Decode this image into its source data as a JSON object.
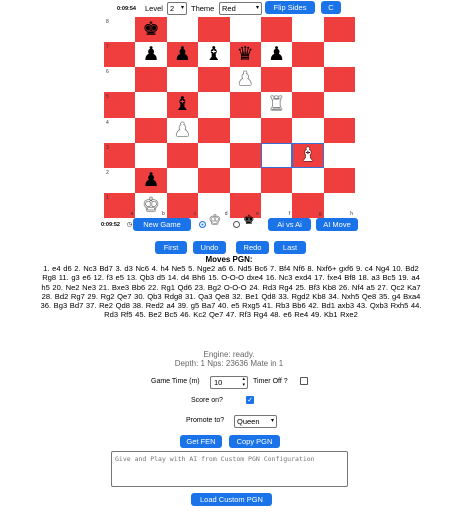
{
  "top_bar": {
    "timer_top": "0:09:54",
    "level_label": "Level",
    "level_value": "2",
    "theme_label": "Theme",
    "theme_value": "Red",
    "flip_label": "Flip Sides",
    "c_label": "C"
  },
  "board": {
    "files": [
      "a",
      "b",
      "c",
      "d",
      "e",
      "f",
      "g",
      "h"
    ],
    "ranks": [
      "8",
      "7",
      "6",
      "5",
      "4",
      "3",
      "2",
      "1"
    ],
    "rows": [
      [
        "",
        "bK",
        "",
        "",
        "",
        "",
        "",
        ""
      ],
      [
        "",
        "bP",
        "bP",
        "bB",
        "bQ",
        "bP",
        "",
        ""
      ],
      [
        "",
        "",
        "",
        "",
        "wP",
        "",
        "",
        ""
      ],
      [
        "",
        "",
        "bB",
        "",
        "",
        "wR",
        "",
        ""
      ],
      [
        "",
        "",
        "wP",
        "",
        "",
        "",
        "",
        ""
      ],
      [
        "",
        "",
        "",
        "",
        "",
        "",
        "wB",
        ""
      ],
      [
        "",
        "bP",
        "",
        "",
        "",
        "",
        "",
        ""
      ],
      [
        "",
        "wK",
        "",
        "",
        "",
        "",
        "",
        ""
      ]
    ],
    "highlight": [
      [
        5,
        5
      ],
      [
        5,
        6
      ]
    ]
  },
  "controls": {
    "timer_bottom": "0:09:52",
    "new_game_label": "New Game",
    "ai_vs_ai_label": "Ai vs Ai",
    "ai_move_label": "AI Move",
    "first_label": "First",
    "undo_label": "Undo",
    "redo_label": "Redo",
    "last_label": "Last"
  },
  "moves": {
    "title": "Moves PGN:",
    "text": "1. e4 d6 2. Nc3 Bd7 3. d3 Nc6 4. h4 Ne5 5. Nge2 a6 6. Nd5 Bc6 7. Bf4 Nf6 8. Nxf6+ gxf6 9. c4 Ng4 10. Bd2 Rg8 11. g3 e6 12. f3 e5 13. Qb3 d5 14. d4 Bh6 15. O-O-O dxe4 16. Nc3 exd4 17. fxe4 Bf8 18. a3 Bc5 19. a4 h5 20. Ne2 Ne3 21. Bxe3 Bb6 22. Rg1 Qd6 23. Bg2 O-O-O 24. Rd3 Rg4 25. Bf3 Kb8 26. Nf4 a5 27. Qc2 Ka7 28. Bd2 Rg7 29. Rg2 Qe7 30. Qb3 Rdg8 31. Qa3 Qe8 32. Be1 Qd8 33. Rgd2 Kb8 34. Nxh5 Qe8 35. g4 Bxa4 36. Bg3 Bd7 37. Re2 Qd8 38. Red2 a4 39. g5 Ba7 40. e5 Rxg5 41. Rb3 Bb6 42. Bd1 axb3 43. Qxb3 Rxh5 44. Rd3 Rf5 45. Be2 Bc5 46. Kc2 Qe7 47. Rf3 Rg4 48. e6 Re4 49. Kb1 Rxe2"
  },
  "engine": {
    "status": "Engine: ready.",
    "depth": "Depth: 1 Nps: 23636 Mate in 1"
  },
  "settings": {
    "game_time_label": "Game Time (m)",
    "game_time_value": "10",
    "timer_off_label": "Timer Off ?",
    "score_on_label": "Score on?",
    "promote_label": "Promote to?",
    "promote_value": "Queen",
    "get_fen_label": "Get FEN",
    "copy_pgn_label": "Copy PGN",
    "textarea_placeholder": "Give and Play with AI from Custom PGN Configuration",
    "load_pgn_label": "Load Custom PGN"
  }
}
